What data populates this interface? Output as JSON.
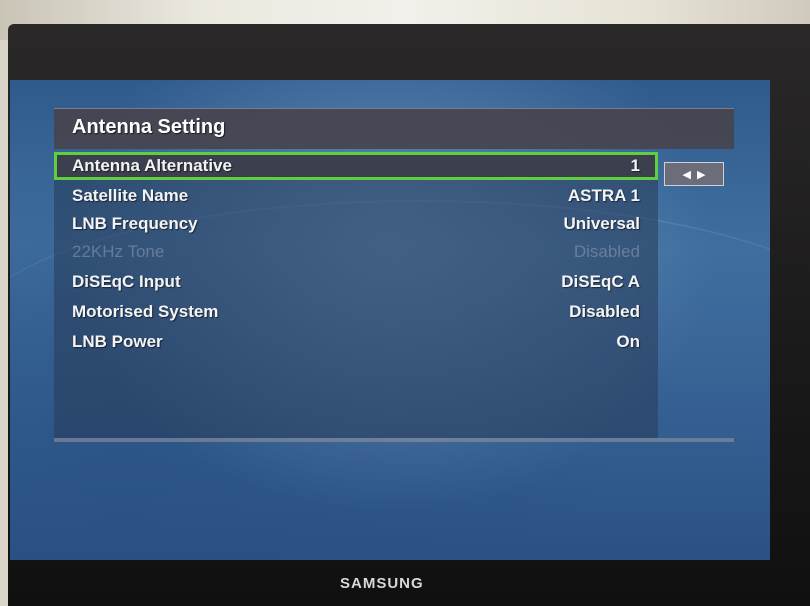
{
  "panel": {
    "title": "Antenna Setting",
    "rows": [
      {
        "label": "Antenna Alternative",
        "value": "1",
        "selected": true,
        "disabled": false
      },
      {
        "label": "Satellite Name",
        "value": "ASTRA 1",
        "selected": false,
        "disabled": false
      },
      {
        "label": "LNB Frequency",
        "value": "Universal",
        "selected": false,
        "disabled": false
      },
      {
        "label": "22KHz Tone",
        "value": "Disabled",
        "selected": false,
        "disabled": true
      },
      {
        "label": "DiSEqC Input",
        "value": "DiSEqC A",
        "selected": false,
        "disabled": false
      },
      {
        "label": "Motorised System",
        "value": "Disabled",
        "selected": false,
        "disabled": false
      },
      {
        "label": "LNB Power",
        "value": "On",
        "selected": false,
        "disabled": false
      }
    ],
    "arrow_left": "◀",
    "arrow_right": "▶"
  },
  "monitor": {
    "brand": "SAMSUNG"
  },
  "colors": {
    "selection_outline": "#5ecf3f",
    "title_bar": "#46444e",
    "screen_background": "#3f6f9f"
  }
}
